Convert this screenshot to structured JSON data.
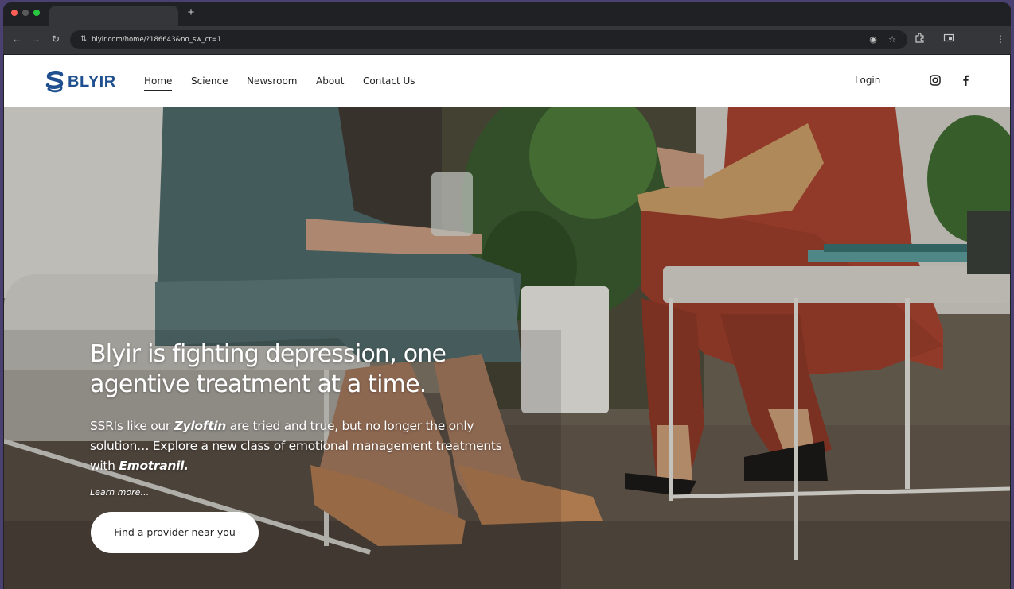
{
  "browser": {
    "new_tab_symbol": "+",
    "url": "blyir.com/home/?186643&no_sw_cr=1",
    "icons": [
      "back-icon",
      "forward-icon",
      "reload-icon",
      "site-settings-icon",
      "eye-icon",
      "star-icon",
      "extensions-icon",
      "cast-icon",
      "menu-icon"
    ]
  },
  "nav": {
    "logo_text": "BLYIR",
    "links": [
      "Home",
      "Science",
      "Newsroom",
      "About",
      "Contact Us"
    ],
    "active_link": "Home",
    "login": "Login",
    "social": [
      "instagram-icon",
      "facebook-icon"
    ]
  },
  "hero": {
    "title_line1": "Blyir is fighting depression, one",
    "title_line2": "agentive treatment at a time.",
    "body_1": "SSRIs like our ",
    "body_product1": "Zyloftin",
    "body_2": " are tried and true, but no longer the only solution… Explore a new class of emotional management treatments with ",
    "body_product2": "Emotranil.",
    "learn_more": "Learn more…",
    "cta": "Find a provider near you"
  },
  "colors": {
    "brand": "#1f4f8e",
    "nav_bg": "#ffffff",
    "cta_bg": "#ffffff",
    "hero_text": "#ffffff"
  }
}
